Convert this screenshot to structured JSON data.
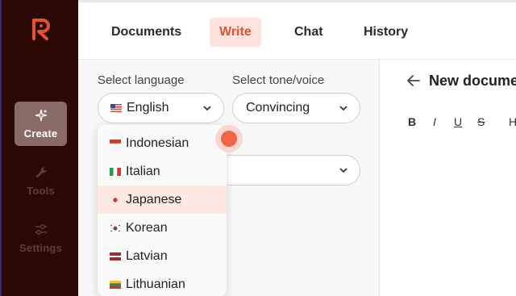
{
  "sidebar": {
    "logo": "R",
    "items": [
      {
        "label": "Create",
        "icon": "sparkle-icon",
        "active": true
      },
      {
        "label": "Tools",
        "icon": "wrench-icon",
        "active": false
      },
      {
        "label": "Settings",
        "icon": "sliders-icon",
        "active": false
      }
    ]
  },
  "tabs": [
    {
      "label": "Documents",
      "active": false
    },
    {
      "label": "Write",
      "active": true
    },
    {
      "label": "Chat",
      "active": false
    },
    {
      "label": "History",
      "active": false
    }
  ],
  "form": {
    "language_label": "Select language",
    "language_value": "English",
    "tone_label": "Select tone/voice",
    "tone_value": "Convincing"
  },
  "language_options": [
    {
      "label": "Indonesian",
      "flag": "indonesia"
    },
    {
      "label": "Italian",
      "flag": "italy"
    },
    {
      "label": "Japanese",
      "flag": "japan",
      "highlighted": true
    },
    {
      "label": "Korean",
      "flag": "korea"
    },
    {
      "label": "Latvian",
      "flag": "latvia"
    },
    {
      "label": "Lithuanian",
      "flag": "lithuania"
    }
  ],
  "editor": {
    "title": "New docume",
    "toolbar": [
      "B",
      "I",
      "U",
      "S",
      "H"
    ]
  },
  "colors": {
    "accent": "#e2522f",
    "sidebar_bg": "#2b0a05",
    "active_tab_bg": "#fde3dc"
  }
}
